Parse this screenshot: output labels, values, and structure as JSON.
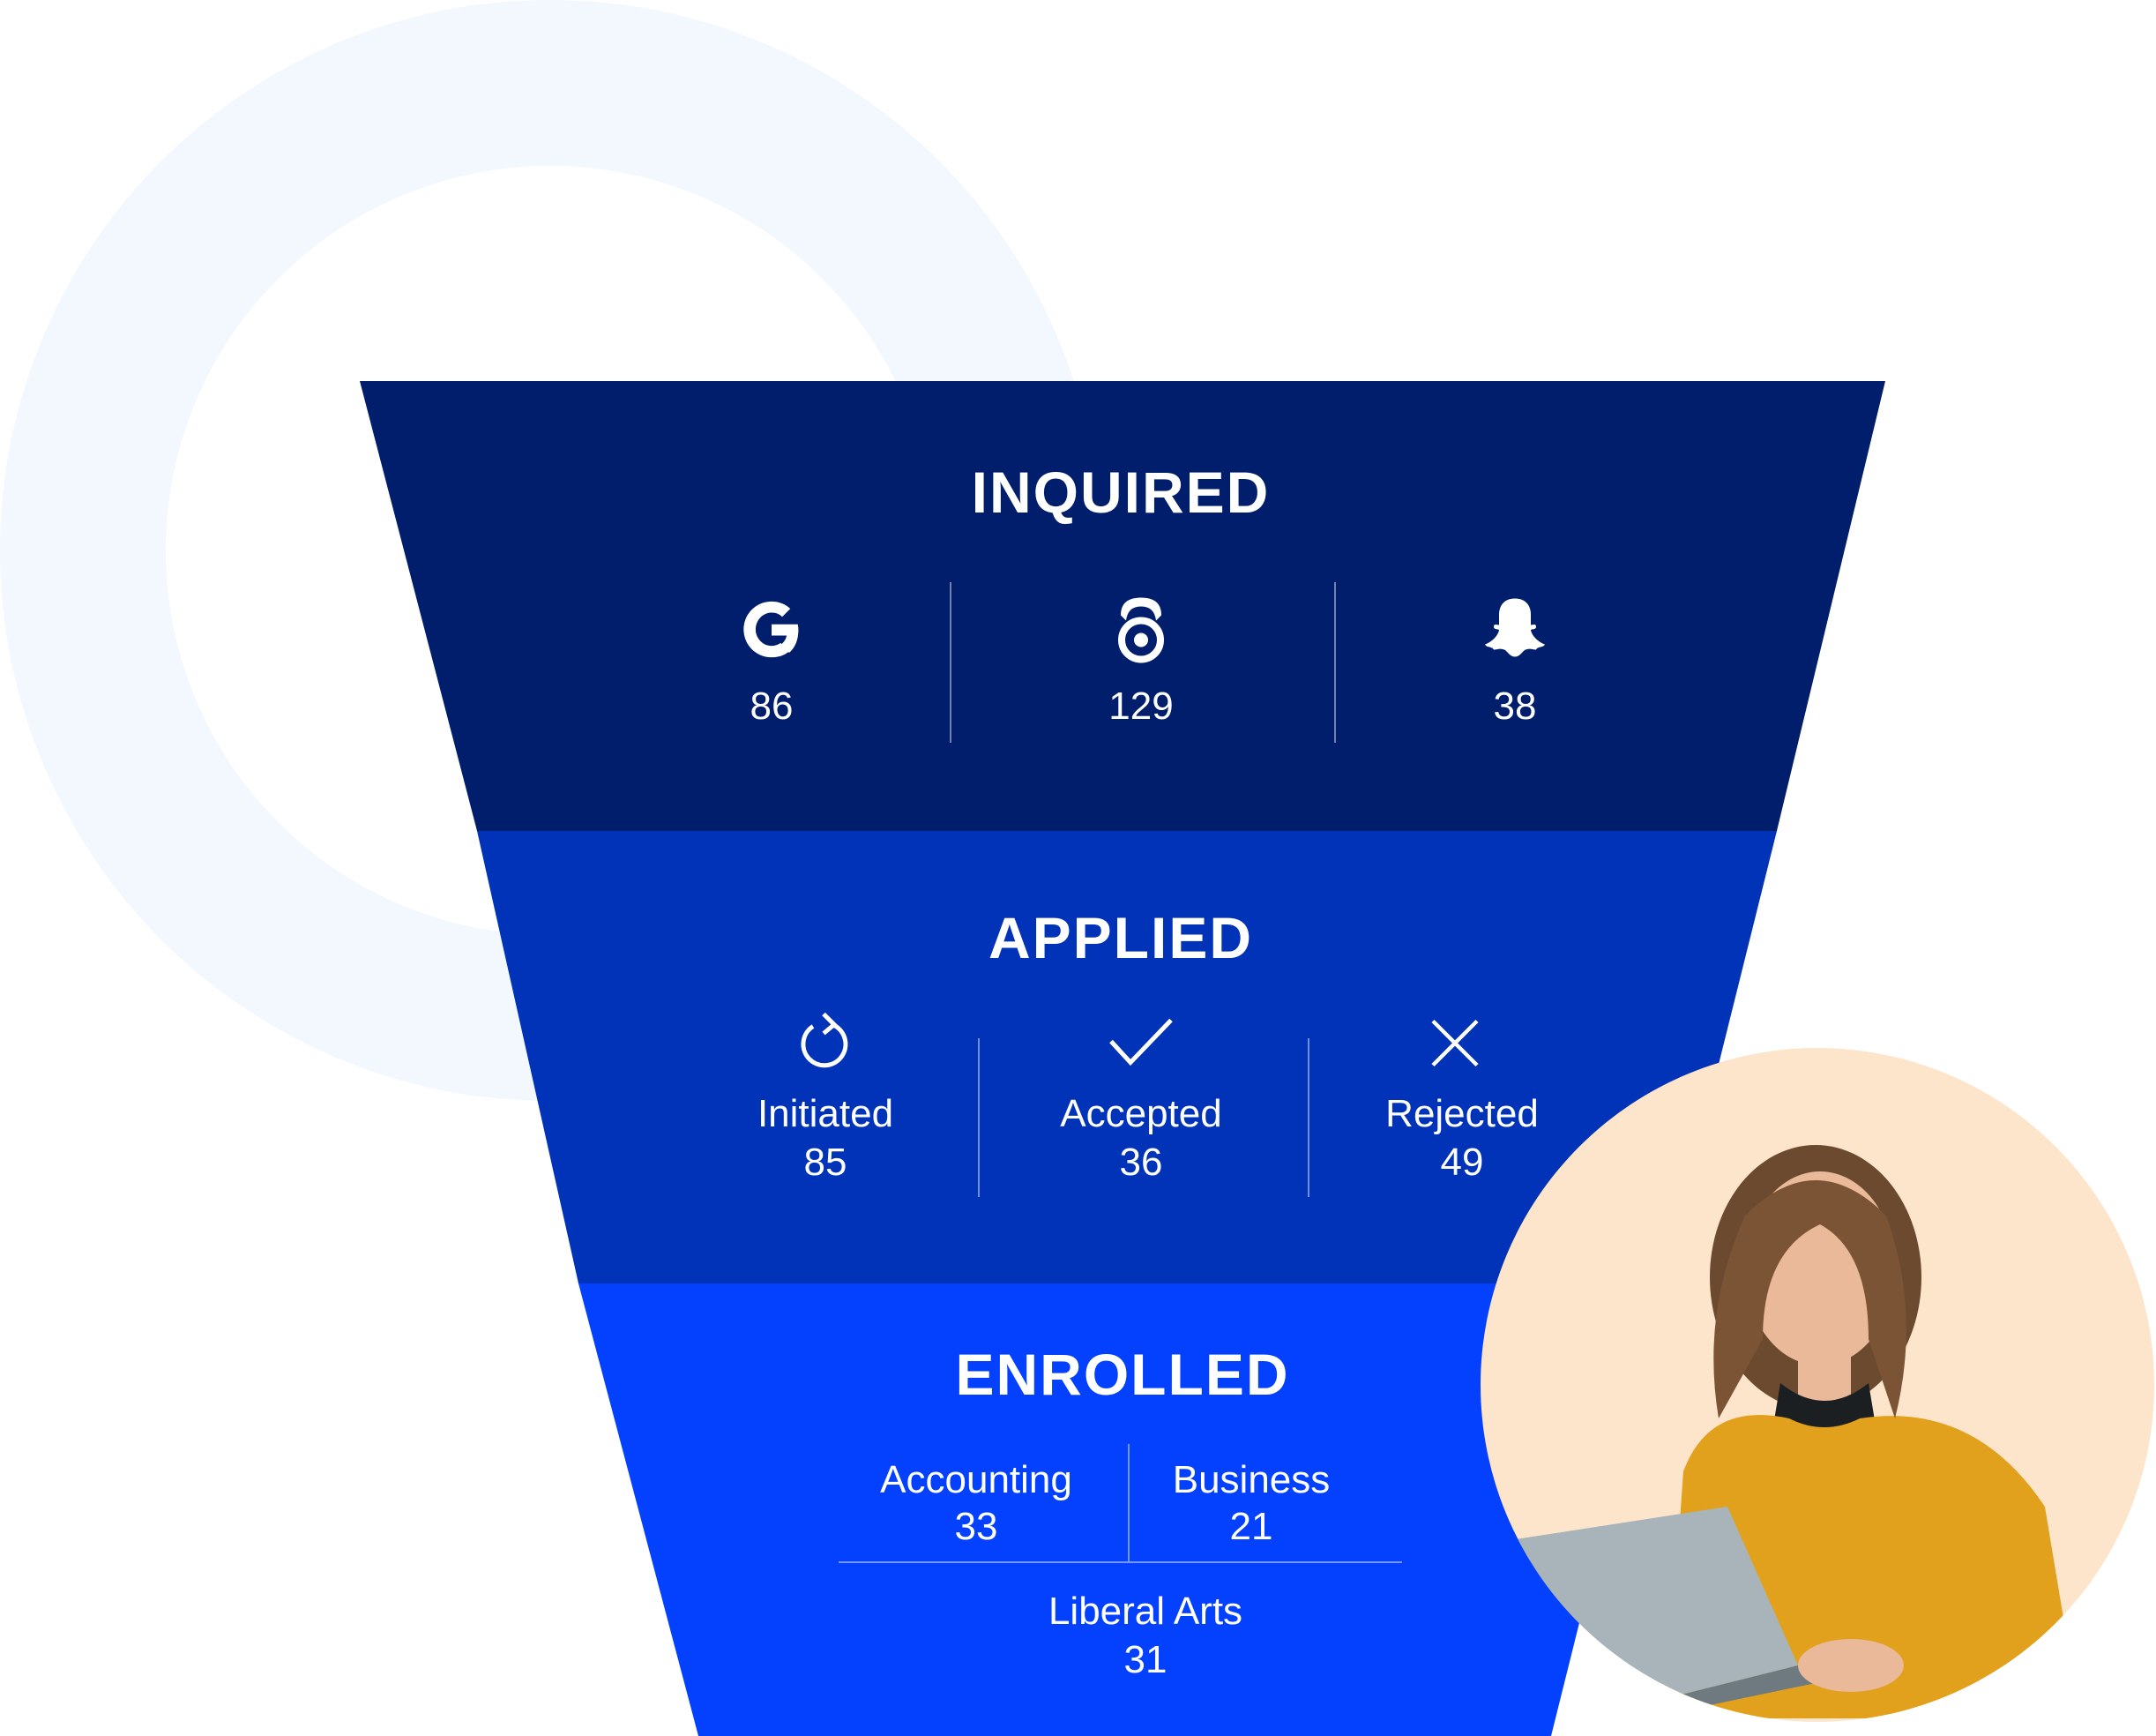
{
  "colors": {
    "inquired": "#011e6c",
    "applied": "#0033b8",
    "enrolled": "#0441ff",
    "ring": "#f3f7fe",
    "photo_bg": "#fde5cb"
  },
  "inquired": {
    "title": "INQUIRED",
    "sources": [
      {
        "icon": "google-icon",
        "value": "86"
      },
      {
        "icon": "podcast-icon",
        "value": "129"
      },
      {
        "icon": "snapchat-icon",
        "value": "38"
      }
    ]
  },
  "applied": {
    "title": "APPLIED",
    "statuses": [
      {
        "icon": "refresh-icon",
        "label": "Initiated",
        "value": "85"
      },
      {
        "icon": "check-icon",
        "label": "Accepted",
        "value": "36"
      },
      {
        "icon": "close-icon",
        "label": "Rejected",
        "value": "49"
      }
    ]
  },
  "enrolled": {
    "title": "ENROLLED",
    "programs": [
      {
        "label": "Accounting",
        "value": "33"
      },
      {
        "label": "Business",
        "value": "21"
      },
      {
        "label": "Liberal Arts",
        "value": "31"
      }
    ]
  }
}
